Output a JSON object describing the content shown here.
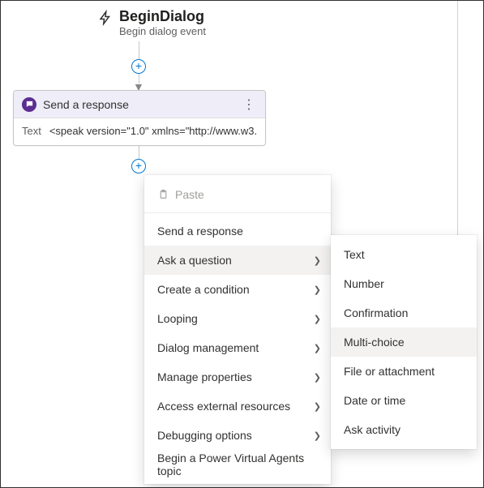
{
  "trigger": {
    "title": "BeginDialog",
    "subtitle": "Begin dialog event"
  },
  "node": {
    "title": "Send a response",
    "body_label": "Text",
    "body_value": "<speak version=\"1.0\" xmlns=\"http://www.w3...."
  },
  "menu": {
    "paste": "Paste",
    "items": [
      {
        "label": "Send a response",
        "submenu": false
      },
      {
        "label": "Ask a question",
        "submenu": true,
        "hover": true
      },
      {
        "label": "Create a condition",
        "submenu": true
      },
      {
        "label": "Looping",
        "submenu": true
      },
      {
        "label": "Dialog management",
        "submenu": true
      },
      {
        "label": "Manage properties",
        "submenu": true
      },
      {
        "label": "Access external resources",
        "submenu": true
      },
      {
        "label": "Debugging options",
        "submenu": true
      },
      {
        "label": "Begin a Power Virtual Agents topic",
        "submenu": false
      }
    ]
  },
  "submenu": {
    "items": [
      {
        "label": "Text"
      },
      {
        "label": "Number"
      },
      {
        "label": "Confirmation"
      },
      {
        "label": "Multi-choice",
        "hover": true
      },
      {
        "label": "File or attachment"
      },
      {
        "label": "Date or time"
      },
      {
        "label": "Ask activity"
      }
    ]
  }
}
